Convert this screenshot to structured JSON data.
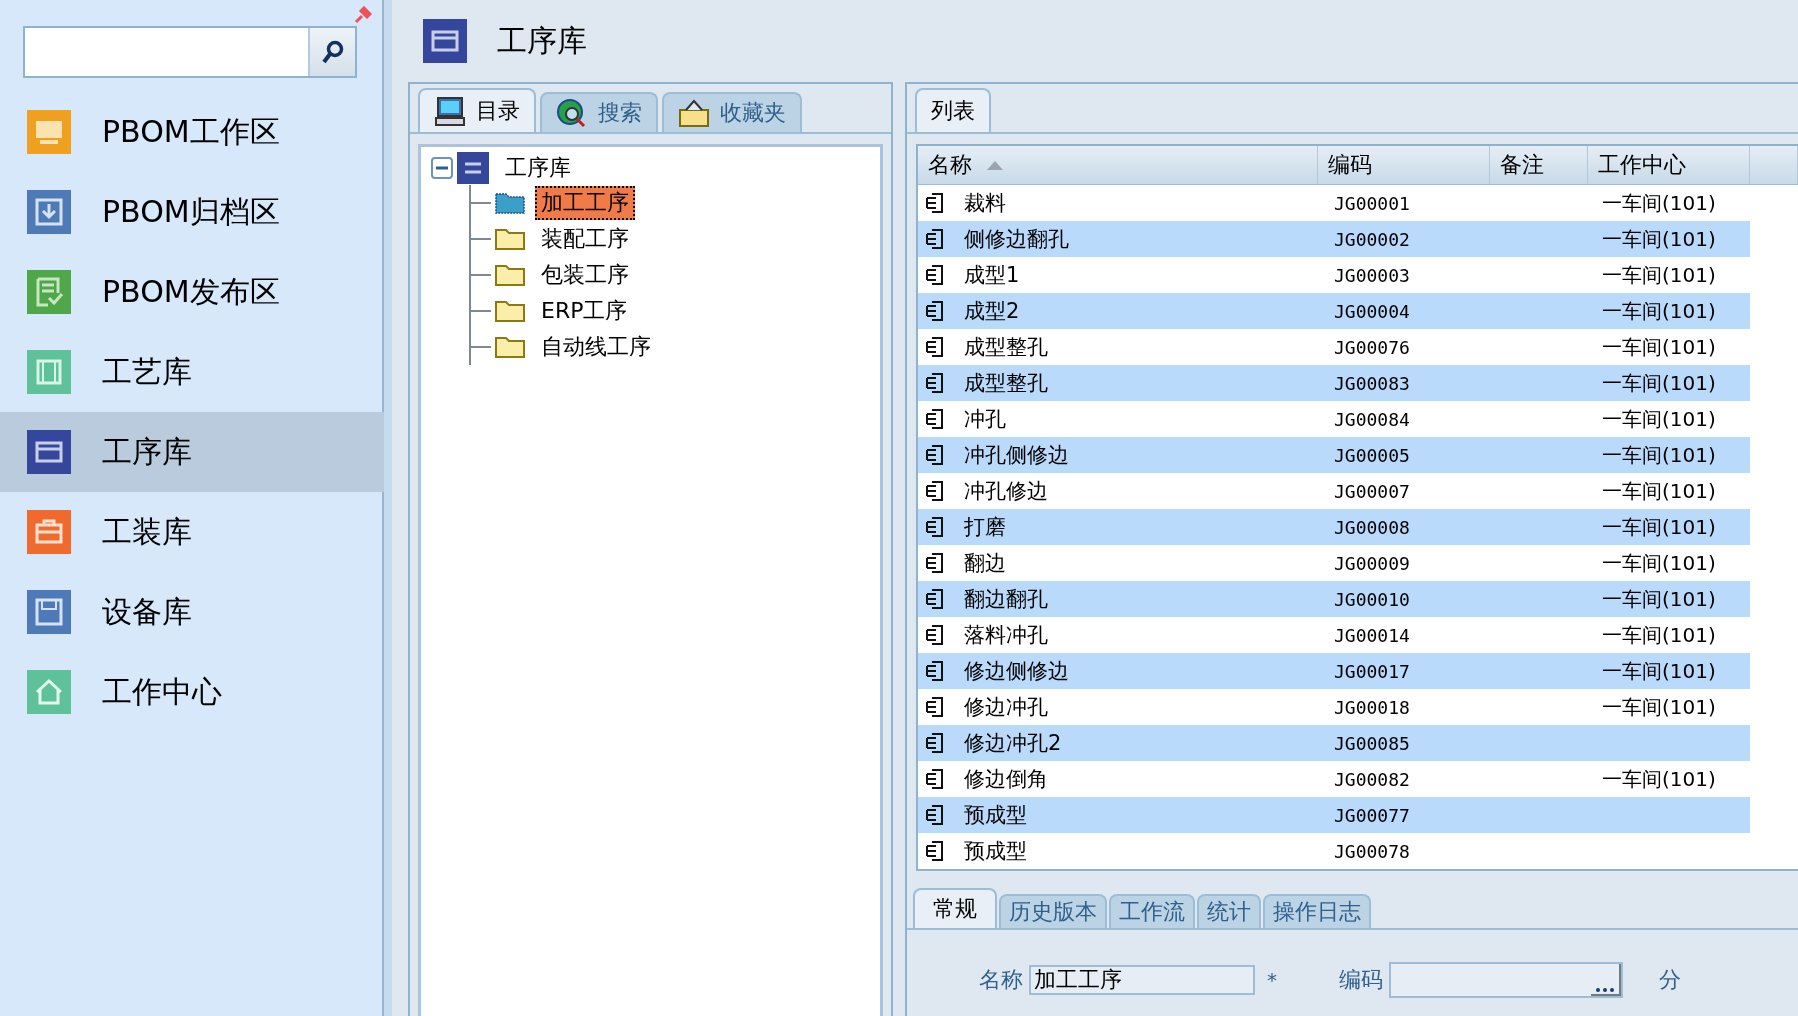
{
  "sidebar": {
    "items": [
      {
        "label": "PBOM工作区",
        "color": "#f0a020",
        "selected": false
      },
      {
        "label": "PBOM归档区",
        "color": "#4f7ab8",
        "selected": false
      },
      {
        "label": "PBOM发布区",
        "color": "#4fa74a",
        "selected": false
      },
      {
        "label": "工艺库",
        "color": "#5fc19a",
        "selected": false
      },
      {
        "label": "工序库",
        "color": "#34479c",
        "selected": true
      },
      {
        "label": "工装库",
        "color": "#ef6a2c",
        "selected": false
      },
      {
        "label": "设备库",
        "color": "#4f7ab8",
        "selected": false
      },
      {
        "label": "工作中心",
        "color": "#5fc19a",
        "selected": false
      }
    ]
  },
  "header": {
    "title": "工序库"
  },
  "tree_panel": {
    "tabs": [
      {
        "label": "目录",
        "selected": true
      },
      {
        "label": "搜索",
        "selected": false
      },
      {
        "label": "收藏夹",
        "selected": false
      }
    ],
    "tree": {
      "label": "工序库",
      "expanded": true,
      "children": [
        {
          "label": "加工工序",
          "selected": true
        },
        {
          "label": "装配工序",
          "selected": false
        },
        {
          "label": "包装工序",
          "selected": false
        },
        {
          "label": "ERP工序",
          "selected": false
        },
        {
          "label": "自动线工序",
          "selected": false
        }
      ]
    }
  },
  "list_panel": {
    "tabs": [
      {
        "label": "列表",
        "selected": true
      }
    ],
    "table": {
      "columns": [
        {
          "label": "名称",
          "sorted": true
        },
        {
          "label": "编码",
          "sorted": false
        },
        {
          "label": "备注",
          "sorted": false
        },
        {
          "label": "工作中心",
          "sorted": false
        }
      ],
      "rows": [
        {
          "name": "裁料",
          "code": "JG00001",
          "work_center": "一车间(101)"
        },
        {
          "name": "侧修边翻孔",
          "code": "JG00002",
          "work_center": "一车间(101)"
        },
        {
          "name": "成型1",
          "code": "JG00003",
          "work_center": "一车间(101)"
        },
        {
          "name": "成型2",
          "code": "JG00004",
          "work_center": "一车间(101)"
        },
        {
          "name": "成型整孔",
          "code": "JG00076",
          "work_center": "一车间(101)"
        },
        {
          "name": "成型整孔",
          "code": "JG00083",
          "work_center": "一车间(101)"
        },
        {
          "name": "冲孔",
          "code": "JG00084",
          "work_center": "一车间(101)"
        },
        {
          "name": "冲孔侧修边",
          "code": "JG00005",
          "work_center": "一车间(101)"
        },
        {
          "name": "冲孔修边",
          "code": "JG00007",
          "work_center": "一车间(101)"
        },
        {
          "name": "打磨",
          "code": "JG00008",
          "work_center": "一车间(101)"
        },
        {
          "name": "翻边",
          "code": "JG00009",
          "work_center": "一车间(101)"
        },
        {
          "name": "翻边翻孔",
          "code": "JG00010",
          "work_center": "一车间(101)"
        },
        {
          "name": "落料冲孔",
          "code": "JG00014",
          "work_center": "一车间(101)"
        },
        {
          "name": "修边侧修边",
          "code": "JG00017",
          "work_center": "一车间(101)"
        },
        {
          "name": "修边冲孔",
          "code": "JG00018",
          "work_center": "一车间(101)"
        },
        {
          "name": "修边冲孔2",
          "code": "JG00085"
        },
        {
          "name": "修边倒角",
          "code": "JG00082",
          "work_center": "一车间(101)"
        },
        {
          "name": "预成型",
          "code": "JG00077"
        },
        {
          "name": "预成型",
          "code": "JG00078"
        }
      ]
    }
  },
  "detail_panel": {
    "tabs": [
      {
        "label": "常规",
        "selected": true
      },
      {
        "label": "历史版本",
        "selected": false
      },
      {
        "label": "工作流",
        "selected": false
      },
      {
        "label": "统计",
        "selected": false
      },
      {
        "label": "操作日志",
        "selected": false
      }
    ],
    "fields": [
      {
        "kind": "text",
        "label": "名称",
        "value": "加工工序",
        "marker": "*"
      },
      {
        "kind": "browse",
        "label": "编码"
      },
      {
        "kind": "label",
        "label": "分"
      }
    ]
  }
}
